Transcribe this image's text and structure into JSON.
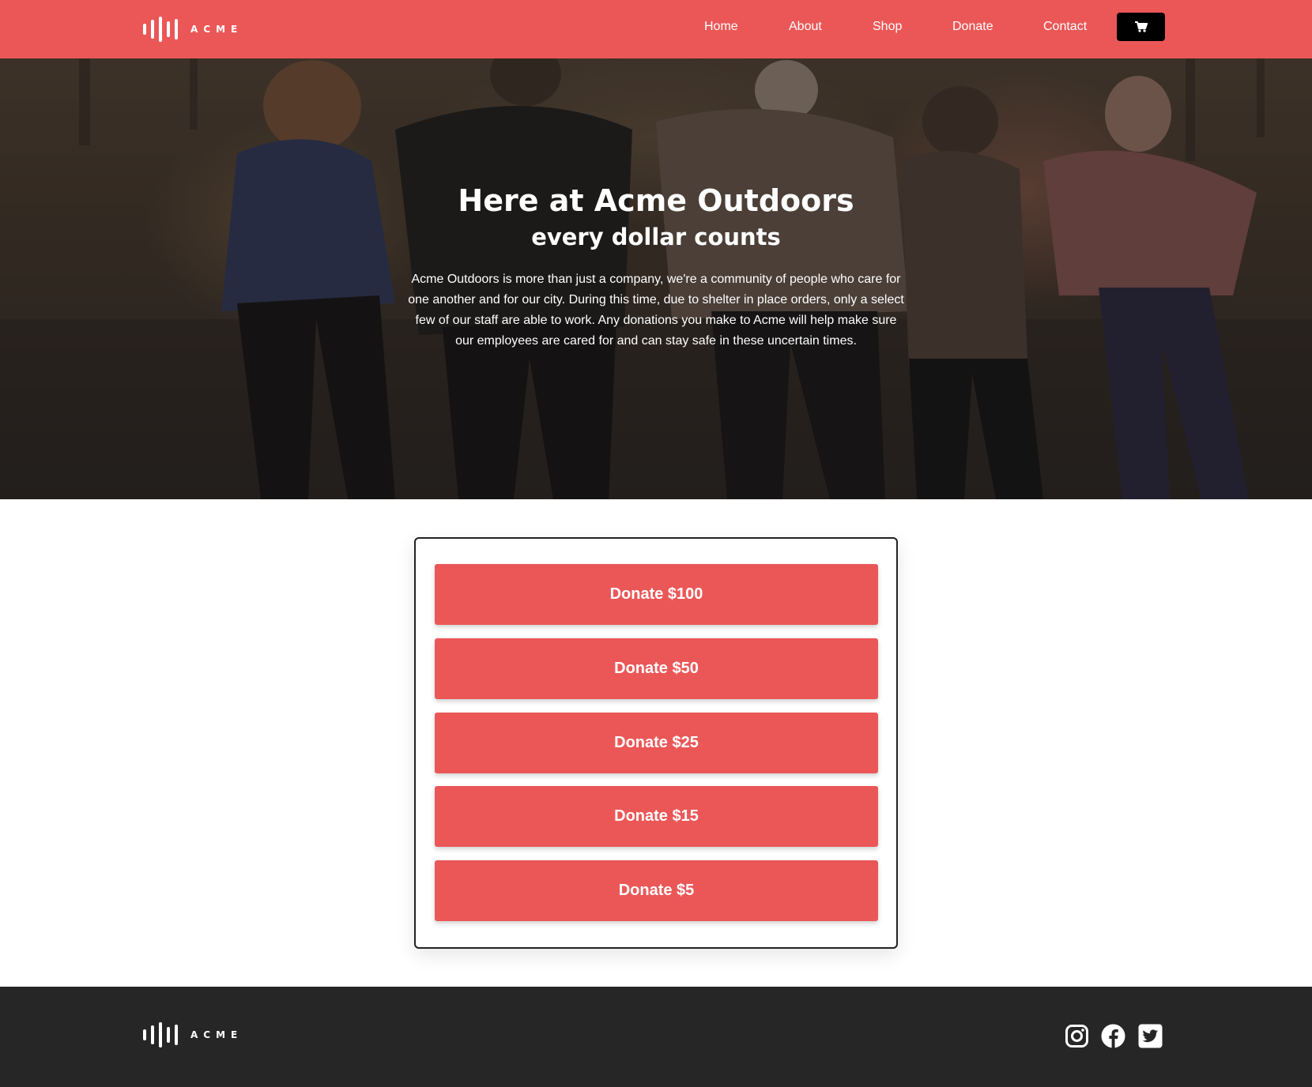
{
  "header": {
    "logo_text": "ACME",
    "nav": [
      {
        "label": "Home"
      },
      {
        "label": "About"
      },
      {
        "label": "Shop"
      },
      {
        "label": "Donate"
      },
      {
        "label": "Contact"
      }
    ],
    "cart_icon": "shopping-cart-icon"
  },
  "hero": {
    "title": "Here at Acme Outdoors",
    "subtitle": "every dollar counts",
    "body": "Acme Outdoors is more than just a company, we're a community of people who care for one another and for our city. During this time, due to shelter in place orders, only a select few of our staff are able to work. Any donations you make to Acme will help make sure our employees are cared for and can stay safe in these uncertain times."
  },
  "donations": [
    {
      "label": "Donate $100"
    },
    {
      "label": "Donate $50"
    },
    {
      "label": "Donate $25"
    },
    {
      "label": "Donate $15"
    },
    {
      "label": "Donate $5"
    }
  ],
  "footer": {
    "logo_text": "ACME",
    "social_icons": [
      "instagram-icon",
      "facebook-icon",
      "twitter-icon"
    ]
  },
  "colors": {
    "brand": "#eb5757",
    "footer_bg": "#262626",
    "cart_bg": "#000000"
  }
}
